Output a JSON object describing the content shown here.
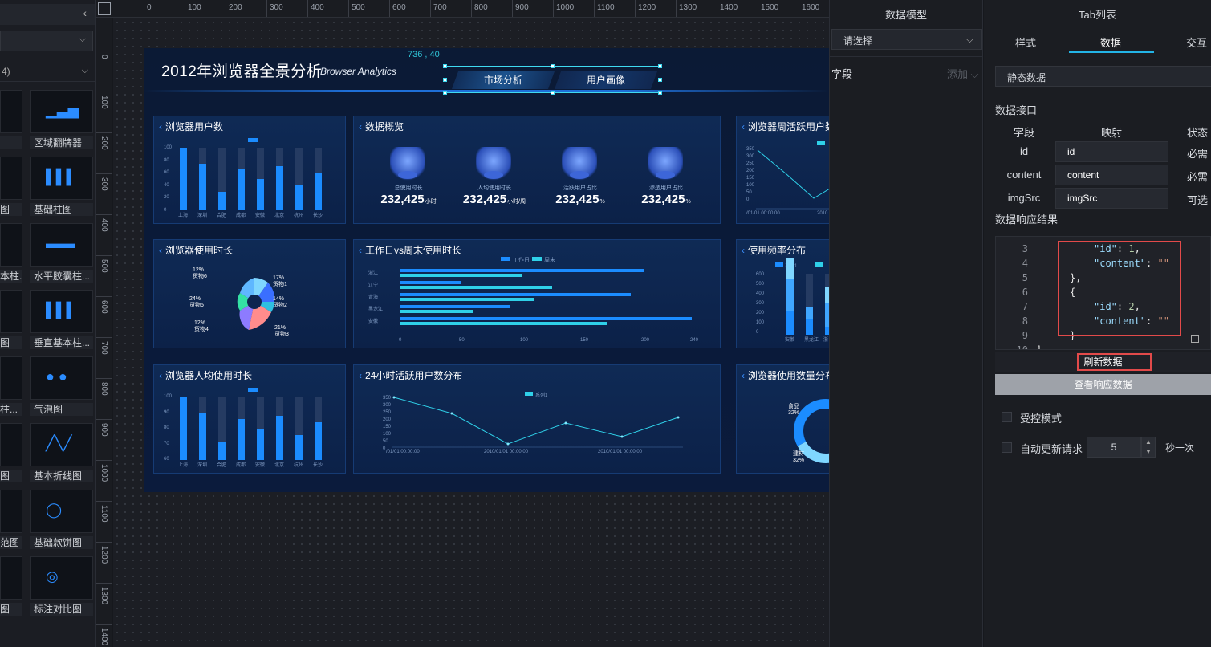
{
  "left_panel": {
    "top_label": "",
    "select2": "4)",
    "components": [
      {
        "label": "区域翻牌器"
      },
      {
        "label": "基础柱图"
      },
      {
        "label": "水平胶囊柱..."
      },
      {
        "label": "垂直基本柱..."
      },
      {
        "label": "气泡图"
      },
      {
        "label": "基本折线图"
      },
      {
        "label": "基础款饼图"
      },
      {
        "label": "标注对比图"
      }
    ],
    "left_col_labels": [
      "",
      "图",
      "本柱...",
      "图",
      "柱...",
      "图",
      "范图",
      "图"
    ]
  },
  "ruler": {
    "top": [
      "0",
      "100",
      "200",
      "300",
      "400",
      "500",
      "600",
      "700",
      "800",
      "900",
      "1000",
      "1100",
      "1200",
      "1300",
      "1400",
      "1500",
      "1600"
    ],
    "left": [
      "0",
      "100",
      "200",
      "300",
      "400",
      "500",
      "600",
      "700",
      "800",
      "900",
      "1000",
      "1100",
      "1200",
      "1300",
      "1400"
    ]
  },
  "canvas": {
    "coord": "736 , 40",
    "dashboard": {
      "title": "2012年浏览器全景分析",
      "subtitle": "Browser Analytics",
      "tabs": [
        "市场分析",
        "用户画像"
      ],
      "cards": {
        "users": "浏览器用户数",
        "overview": "数据概览",
        "weekly": "浏览器周活跃用户数",
        "duration": "浏览器使用时长",
        "workday": "工作日vs周末使用时长",
        "freq": "使用频率分布",
        "avg": "浏览器人均使用时长",
        "active24": "24小时活跃用户数分布",
        "count": "浏览器使用数量分布"
      },
      "kpis": [
        {
          "label": "总使用时长",
          "value": "232,425",
          "unit": "小时"
        },
        {
          "label": "人均使用时长",
          "value": "232,425",
          "unit": "小时/周"
        },
        {
          "label": "活跃用户占比",
          "value": "232,425",
          "unit": "%"
        },
        {
          "label": "渗透用户占比",
          "value": "232,425",
          "unit": "%"
        }
      ],
      "bar_cities": [
        "上海",
        "深圳",
        "合肥",
        "成都",
        "安徽",
        "北京",
        "杭州",
        "长沙"
      ],
      "bar_values": [
        100,
        75,
        30,
        65,
        50,
        70,
        40,
        60
      ],
      "bar_yticks": [
        "100",
        "80",
        "60",
        "40",
        "20",
        "0"
      ],
      "avg_values": [
        100,
        75,
        30,
        65,
        50,
        70,
        40,
        60
      ],
      "avg_yticks": [
        "100",
        "90",
        "80",
        "70",
        "60"
      ],
      "pie_labels": [
        {
          "pct": "12%",
          "name": "货物6"
        },
        {
          "pct": "17%",
          "name": "货物1"
        },
        {
          "pct": "24%",
          "name": "货物5"
        },
        {
          "pct": "14%",
          "name": "货物2"
        },
        {
          "pct": "12%",
          "name": "货物4"
        },
        {
          "pct": "21%",
          "name": "货物3"
        }
      ],
      "workday_legend": [
        "工作日",
        "周末"
      ],
      "workday_rows": [
        {
          "name": "浙江",
          "a": 200,
          "b": 100
        },
        {
          "name": "辽宁",
          "a": 50,
          "b": 125
        },
        {
          "name": "青海",
          "a": 190,
          "b": 110
        },
        {
          "name": "黑龙江",
          "a": 90,
          "b": 60
        },
        {
          "name": "安徽",
          "a": 240,
          "b": 170
        }
      ],
      "workday_xticks": [
        "0",
        "50",
        "100",
        "150",
        "200",
        "240"
      ],
      "line_yticks": [
        "350",
        "300",
        "250",
        "200",
        "150",
        "100",
        "50",
        "0"
      ],
      "line_xticks": [
        "/01/01 00:00:00",
        "2010/01/01 00:00:00",
        "2010/01/01 00:00:00"
      ],
      "line_legend": "系列1",
      "freq_yticks": [
        "600",
        "500",
        "400",
        "300",
        "200",
        "100",
        "0"
      ],
      "freq_cats": [
        "安徽",
        "黑龙江",
        "浙"
      ],
      "freq_legend": [
        "系列1"
      ],
      "weekly_yticks": [
        "350",
        "300",
        "250",
        "200",
        "150",
        "100",
        "50",
        "0"
      ],
      "weekly_xticks": [
        "/01/01 00:00:00",
        "2010"
      ],
      "donut_labels": [
        {
          "name": "食品",
          "pct": "32%"
        },
        {
          "name": "建材",
          "pct": "32%"
        }
      ]
    }
  },
  "data_model_panel": {
    "title": "数据模型",
    "select": "请选择",
    "field_label": "字段",
    "add_label": "添加"
  },
  "tab_panel": {
    "title": "Tab列表",
    "tabs": [
      "样式",
      "数据",
      "交互"
    ],
    "active_tab": "数据",
    "source": "静态数据",
    "api_label": "数据接口",
    "headers": {
      "field": "字段",
      "map": "映射",
      "status": "状态"
    },
    "fields": [
      {
        "field": "id",
        "map": "id",
        "status": "必需"
      },
      {
        "field": "content",
        "map": "content",
        "status": "必需"
      },
      {
        "field": "imgSrc",
        "map": "imgSrc",
        "status": "可选"
      }
    ],
    "response_label": "数据响应结果",
    "code": {
      "line_numbers": [
        "3",
        "4",
        "5",
        "6",
        "7",
        "8",
        "9",
        "10"
      ],
      "lines": [
        {
          "indent": "  ",
          "key": "\"id\"",
          "sep": ": ",
          "val": "1",
          "type": "num",
          "tail": ","
        },
        {
          "indent": "  ",
          "key": "\"content\"",
          "sep": ": ",
          "val": "\"\"",
          "type": "str",
          "tail": ""
        },
        {
          "indent": "",
          "key": "",
          "sep": "",
          "val": "},",
          "type": "plain",
          "tail": ""
        },
        {
          "indent": "",
          "key": "",
          "sep": "",
          "val": "{",
          "type": "plain",
          "tail": ""
        },
        {
          "indent": "  ",
          "key": "\"id\"",
          "sep": ": ",
          "val": "2",
          "type": "num",
          "tail": ","
        },
        {
          "indent": "  ",
          "key": "\"content\"",
          "sep": ": ",
          "val": "\"\"",
          "type": "str",
          "tail": ""
        },
        {
          "indent": "",
          "key": "",
          "sep": "",
          "val": "}",
          "type": "plain",
          "tail": ""
        },
        {
          "indent": "",
          "key": "",
          "sep": "",
          "val": "]",
          "type": "plain",
          "tail": ""
        }
      ]
    },
    "refresh_button": "刷新数据",
    "view_response_button": "查看响应数据",
    "controlled_mode": "受控模式",
    "auto_update": "自动更新请求",
    "interval_value": "5",
    "interval_unit": "秒一次"
  }
}
